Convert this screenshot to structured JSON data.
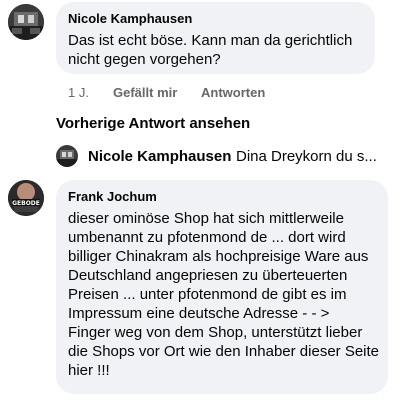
{
  "comment1": {
    "author": "Nicole Kamphausen",
    "text_lines": [
      "Das ist echt böse. Kann man da gerichtlich",
      "nicht gegen vorgehen?"
    ],
    "time": "1 J.",
    "like_label": "Gefällt mir",
    "reply_label": "Antworten"
  },
  "previous_replies_label": "Vorherige Antwort ansehen",
  "reply_preview": {
    "author": "Nicole Kamphausen",
    "snippet": "Dina Dreykorn du s..."
  },
  "comment2": {
    "author": "Frank Jochum",
    "avatar_text": "GEBODE",
    "text_lines": [
      "dieser ominöse Shop hat sich mittlerweile",
      "umbenannt zu pfotenmond de ... dort wird",
      "billiger Chinakram als hochpreisige Ware aus",
      "Deutschland angepriesen zu überteuerten",
      "Preisen ... unter pfotenmond  de gibt es im",
      "Impressum eine deutsche Adresse  - - >",
      "Finger weg von dem Shop, unterstützt lieber",
      "die Shops vor Ort wie den Inhaber dieser Seite",
      "hier !!!"
    ]
  },
  "colors": {
    "bubble": "#f0f2f5",
    "secondary_text": "#65676b",
    "primary_text": "#050505"
  }
}
